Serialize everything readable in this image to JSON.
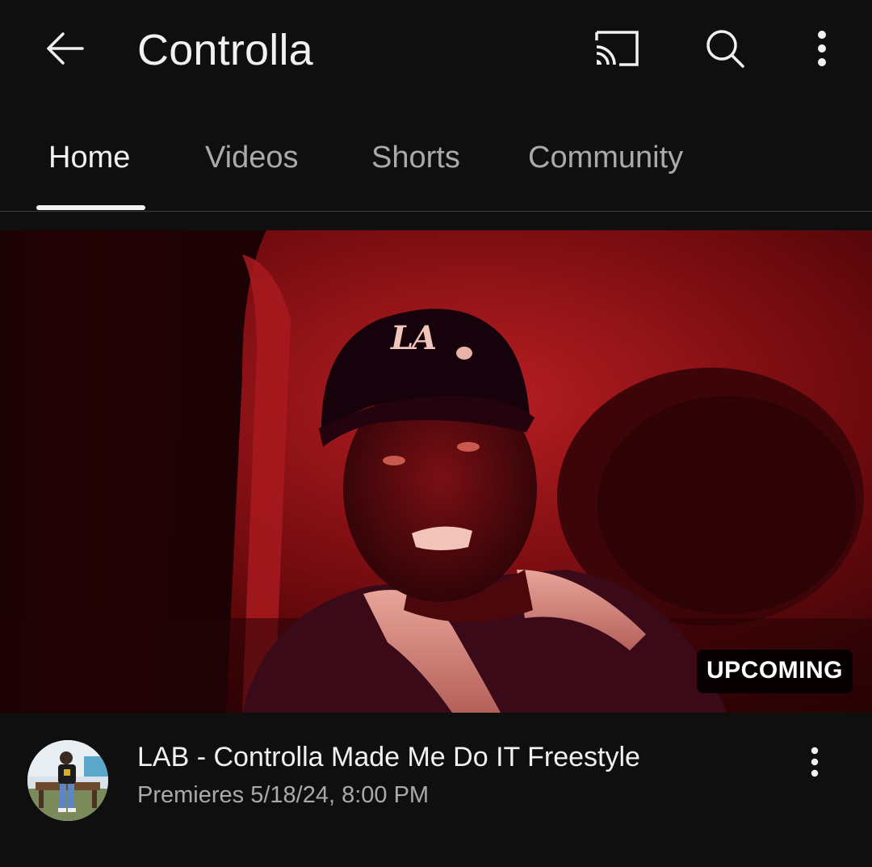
{
  "header": {
    "channel_name": "Controlla",
    "back_icon": "arrow-left-icon",
    "cast_icon": "cast-icon",
    "search_icon": "search-icon",
    "more_icon": "more-vertical-icon"
  },
  "tabs": [
    {
      "label": "Home",
      "active": true
    },
    {
      "label": "Videos",
      "active": false
    },
    {
      "label": "Shorts",
      "active": false
    },
    {
      "label": "Community",
      "active": false
    }
  ],
  "video": {
    "badge": "UPCOMING",
    "title": "LAB - Controlla Made Me Do IT Freestyle",
    "subtitle": "Premieres 5/18/24, 8:00 PM",
    "cap_logo": "LA"
  },
  "colors": {
    "background": "#0f0f0f",
    "text_primary": "#f1f1f1",
    "text_secondary": "#aaaaaa",
    "thumbnail_tint": "#8a0e14"
  }
}
